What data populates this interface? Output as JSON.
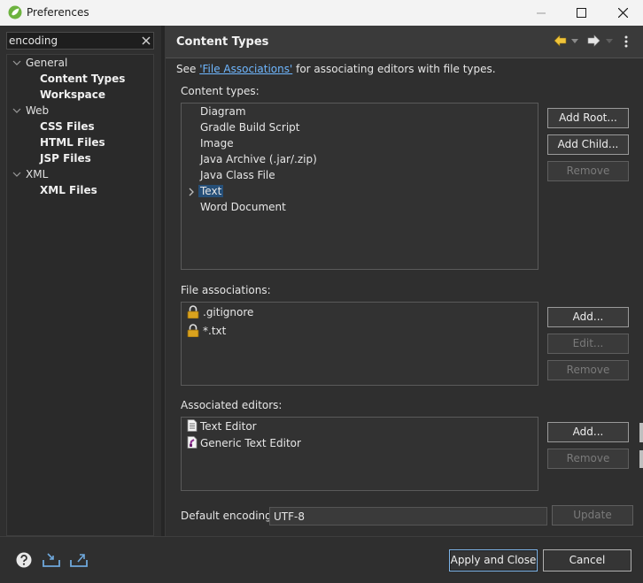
{
  "window": {
    "title": "Preferences"
  },
  "filter": {
    "value": "encoding"
  },
  "tree": {
    "nodes": [
      {
        "label": "General",
        "kind": "category"
      },
      {
        "label": "Content Types",
        "kind": "page",
        "selected": true
      },
      {
        "label": "Workspace",
        "kind": "page"
      },
      {
        "label": "Web",
        "kind": "category"
      },
      {
        "label": "CSS Files",
        "kind": "page"
      },
      {
        "label": "HTML Files",
        "kind": "page"
      },
      {
        "label": "JSP Files",
        "kind": "page"
      },
      {
        "label": "XML",
        "kind": "category"
      },
      {
        "label": "XML Files",
        "kind": "page"
      }
    ]
  },
  "page": {
    "title": "Content Types",
    "see_prefix": "See ",
    "see_link": "'File Associations'",
    "see_suffix": " for associating editors with file types.",
    "content_types_label": "Content types:",
    "content_types": [
      {
        "label": "Diagram"
      },
      {
        "label": "Gradle Build Script"
      },
      {
        "label": "Image"
      },
      {
        "label": "Java Archive (.jar/.zip)"
      },
      {
        "label": "Java Class File"
      },
      {
        "label": "Text",
        "selected": true,
        "expandable": true
      },
      {
        "label": "Word Document"
      }
    ],
    "buttons": {
      "add_root": "Add Root...",
      "add_child": "Add Child...",
      "remove_type": "Remove",
      "add_assoc": "Add...",
      "edit_assoc": "Edit...",
      "remove_assoc": "Remove",
      "add_editor": "Add...",
      "remove_editor": "Remove",
      "update": "Update"
    },
    "file_associations_label": "File associations:",
    "file_associations": [
      {
        "label": ".gitignore",
        "icon": "lock-icon"
      },
      {
        "label": "*.txt",
        "icon": "lock-icon"
      }
    ],
    "associated_editors_label": "Associated editors:",
    "associated_editors": [
      {
        "label": "Text Editor",
        "icon": "text-file-icon"
      },
      {
        "label": "Generic Text Editor",
        "icon": "generic-editor-icon"
      }
    ],
    "default_encoding_label": "Default encoding:",
    "default_encoding_value": "UTF-8"
  },
  "footer": {
    "apply_close": "Apply and Close",
    "cancel": "Cancel"
  },
  "colors": {
    "background": "#2f2f2f",
    "selection": "#264f78",
    "link": "#6fb7ff",
    "default_button_border": "#7db4e8",
    "lock_gold": "#d9a21e"
  }
}
